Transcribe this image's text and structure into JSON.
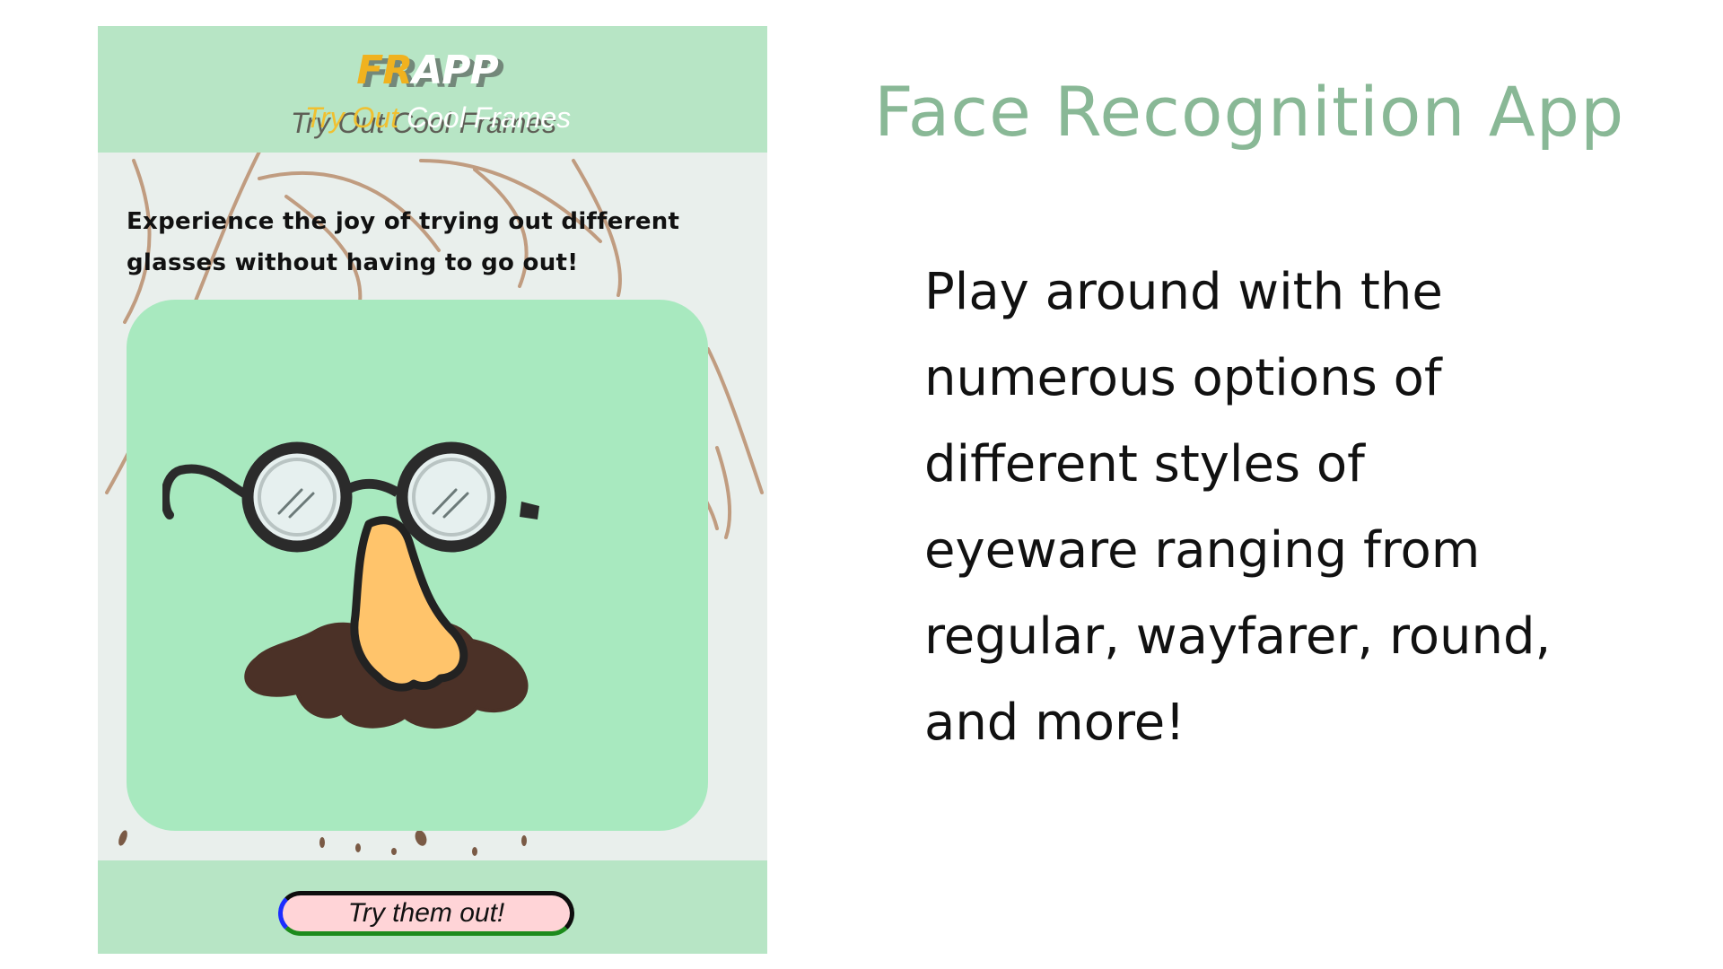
{
  "app": {
    "logo_ghost": "FRAPP",
    "logo_fr": "FR",
    "logo_app": "APP",
    "tagline_ghost": "Try Out Cool Frames",
    "tagline_part1": "Try Out",
    "tagline_part2": " Cool Frames",
    "intro_line1": "Experience the joy of trying out different",
    "intro_line2": "glasses without having to go out!",
    "cta_label": "Try them out!"
  },
  "headline": "Face Recognition App",
  "description": [
    "Play around with the",
    "numerous options of",
    "different styles of",
    "eyeware ranging from",
    "regular, wayfarer, round,",
    "and more!"
  ],
  "colors": {
    "header_green": "#b7e5c5",
    "card_green": "#a8e9bf",
    "headline_green": "#89b896",
    "logo_yellow": "#f0b21f",
    "button_pink": "#ffd4d7"
  },
  "icons": {
    "hero": "glasses-nose-mustache-disguise-icon"
  }
}
